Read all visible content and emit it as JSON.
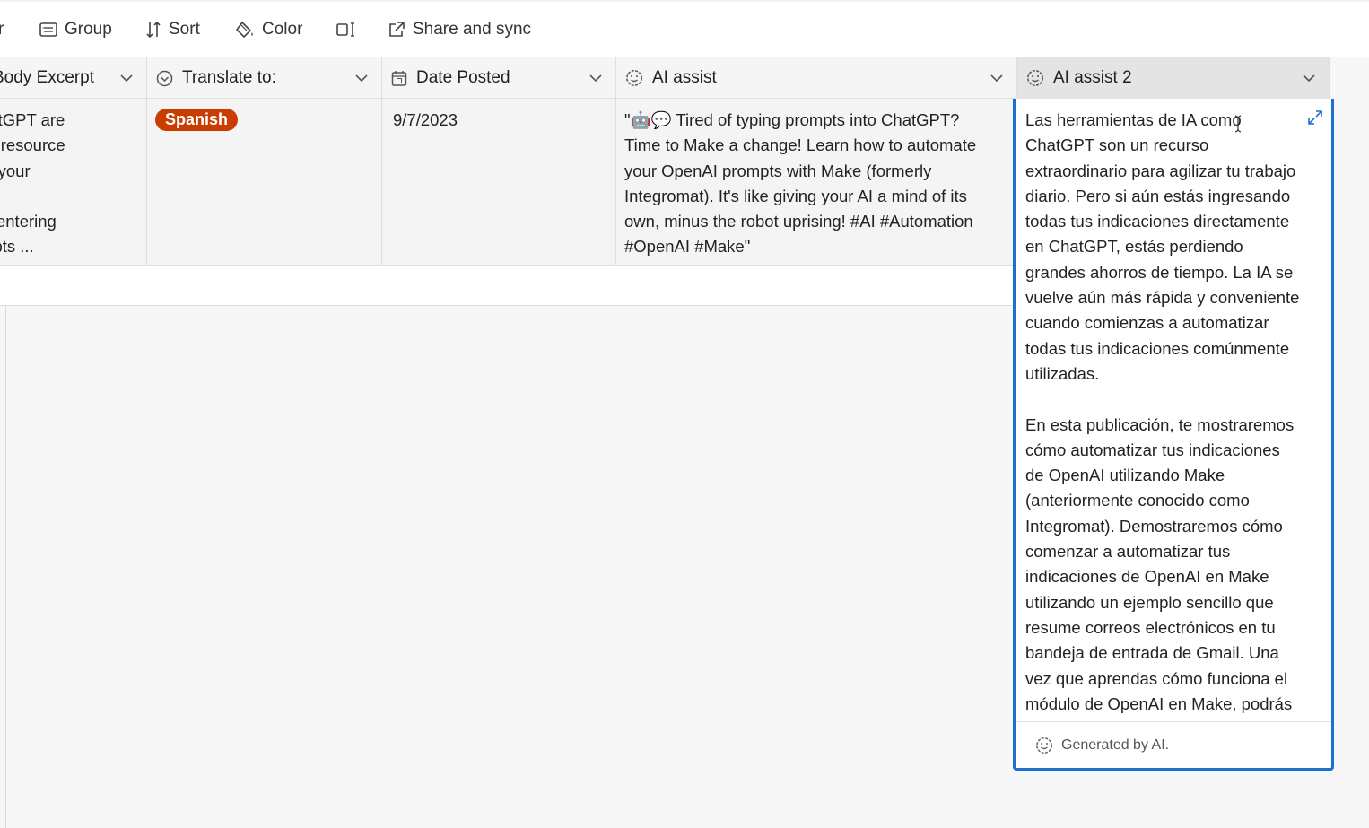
{
  "toolbar": {
    "cut_label": "r",
    "group_label": "Group",
    "sort_label": "Sort",
    "color_label": "Color",
    "share_label": "Share and sync"
  },
  "columns": [
    {
      "label": "Body Excerpt",
      "icon": "text-lines-icon"
    },
    {
      "label": "Translate to:",
      "icon": "single-select-icon"
    },
    {
      "label": "Date Posted",
      "icon": "calendar-icon"
    },
    {
      "label": "AI assist",
      "icon": "ai-smiley-icon"
    },
    {
      "label": "AI assist 2",
      "icon": "ai-smiley-icon"
    }
  ],
  "row": {
    "body_excerpt": "ke ChatGPT are\nrdinary resource\nnlining your\n' work.\n're still entering\nr prompts ...",
    "translate_to": "Spanish",
    "date_posted": "9/7/2023",
    "ai_assist": "\"🤖💬 Tired of typing prompts into ChatGPT?\nTime to Make a change! Learn how to automate\nyour OpenAI prompts with Make (formerly\nIntegromat). It's like giving your AI a mind of its\nown, minus the robot uprising! #AI #Automation\n#OpenAI #Make\""
  },
  "expanded_cell": {
    "text": "Las herramientas de IA como\nChatGPT son un recurso\nextraordinario para agilizar tu trabajo\ndiario. Pero si aún estás ingresando\ntodas tus indicaciones directamente\nen ChatGPT, estás perdiendo\ngrandes ahorros de tiempo. La IA se\nvuelve aún más rápida y conveniente\ncuando comienzas a automatizar\ntodas tus indicaciones comúnmente\nutilizadas.\n\nEn esta publicación, te mostraremos\ncómo automatizar tus indicaciones\nde OpenAI utilizando Make\n(anteriormente conocido como\nIntegromat). Demostraremos cómo\ncomenzar a automatizar tus\nindicaciones de OpenAI en Make\nutilizando un ejemplo sencillo que\nresume correos electrónicos en tu\nbandeja de entrada de Gmail. Una\nvez que aprendas cómo funciona el\nmódulo de OpenAI en Make, podrás",
    "footer": "Generated by AI."
  },
  "colors": {
    "accent": "#1f6fd1",
    "badge": "#c93d00"
  }
}
